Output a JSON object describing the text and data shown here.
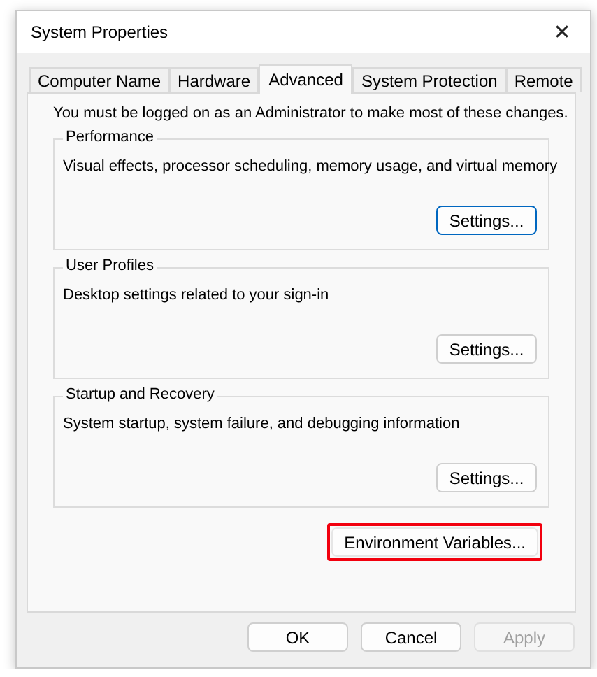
{
  "window": {
    "title": "System Properties",
    "close": "✕"
  },
  "tabs": [
    {
      "label": "Computer Name",
      "selected": false
    },
    {
      "label": "Hardware",
      "selected": false
    },
    {
      "label": "Advanced",
      "selected": true
    },
    {
      "label": "System Protection",
      "selected": false
    },
    {
      "label": "Remote",
      "selected": false
    }
  ],
  "notice": "You must be logged on as an Administrator to make most of these changes.",
  "groups": [
    {
      "label": "Performance",
      "description": "Visual effects, processor scheduling, memory usage, and virtual memory",
      "button": {
        "label": "Settings...",
        "focused": true
      }
    },
    {
      "label": "User Profiles",
      "description": "Desktop settings related to your sign-in",
      "button": {
        "label": "Settings...",
        "focused": false
      }
    },
    {
      "label": "Startup and Recovery",
      "description": "System startup, system failure, and debugging information",
      "button": {
        "label": "Settings...",
        "focused": false
      }
    }
  ],
  "environment_button": {
    "label": "Environment Variables...",
    "highlighted": true
  },
  "dialog_buttons": [
    {
      "label": "OK",
      "disabled": false
    },
    {
      "label": "Cancel",
      "disabled": false
    },
    {
      "label": "Apply",
      "disabled": true
    }
  ]
}
